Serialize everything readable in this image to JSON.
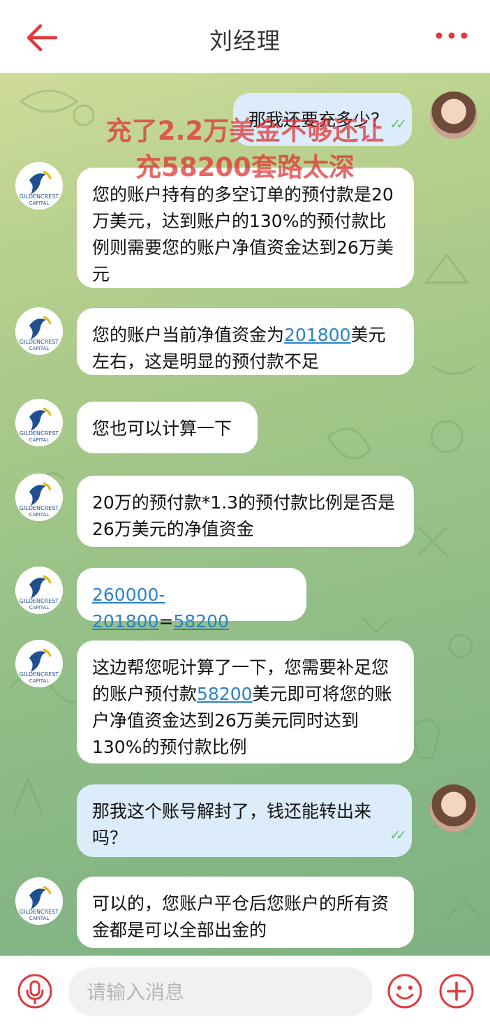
{
  "header": {
    "title": "刘经理",
    "icons": {
      "back": "back-arrow-icon",
      "menu": "more-dots-icon"
    },
    "accent_color": "#e0393e"
  },
  "overlay_text": [
    "充了2.2万美金不够还让",
    "充58200套路太深"
  ],
  "agent_logo": {
    "line1": "GILDENCREST",
    "line2": "CAPITAL"
  },
  "messages": [
    {
      "from": "user",
      "segments": [
        {
          "text": "那我还要充多少？",
          "link": false
        }
      ],
      "read": true
    },
    {
      "from": "agent",
      "segments": [
        {
          "text": "您的账户持有的多空订单的预付款是20万美元，达到账户的130%的预付款比例则需要您的账户净值资金达到26万美元",
          "link": false
        }
      ]
    },
    {
      "from": "agent",
      "segments": [
        {
          "text": "您的账户当前净值资金为",
          "link": false
        },
        {
          "text": "201800",
          "link": true
        },
        {
          "text": "美元左右，这是明显的预付款不足",
          "link": false
        }
      ]
    },
    {
      "from": "agent",
      "segments": [
        {
          "text": "您也可以计算一下",
          "link": false
        }
      ]
    },
    {
      "from": "agent",
      "segments": [
        {
          "text": "20万的预付款*1.3的预付款比例是否是26万美元的净值资金",
          "link": false
        }
      ]
    },
    {
      "from": "agent",
      "segments": [
        {
          "text": "260000-201800",
          "link": true
        },
        {
          "text": "=",
          "link": false
        },
        {
          "text": "58200",
          "link": true
        }
      ]
    },
    {
      "from": "agent",
      "segments": [
        {
          "text": "这边帮您呢计算了一下，您需要补足您的账户预付款",
          "link": false
        },
        {
          "text": "58200",
          "link": true
        },
        {
          "text": "美元即可将您的账户净值资金达到26万美元同时达到130%的预付款比例",
          "link": false
        }
      ]
    },
    {
      "from": "user",
      "segments": [
        {
          "text": "那我这个账号解封了，钱还能转出来吗？",
          "link": false
        }
      ],
      "read": true
    },
    {
      "from": "agent",
      "segments": [
        {
          "text": "可以的，您账户平仓后您账户的所有资金都是可以全部出金的",
          "link": false
        }
      ]
    }
  ],
  "input": {
    "placeholder": "请输入消息",
    "value": "",
    "icons": {
      "voice": "microphone-icon",
      "emoji": "smiley-icon",
      "add": "plus-circle-icon"
    }
  },
  "colors": {
    "link": "#2a82c9",
    "outgoing_bubble": "#dcecfb",
    "incoming_bubble": "#ffffff",
    "read_ticks": "#66bb6a",
    "overlay": "#e12d2d"
  }
}
